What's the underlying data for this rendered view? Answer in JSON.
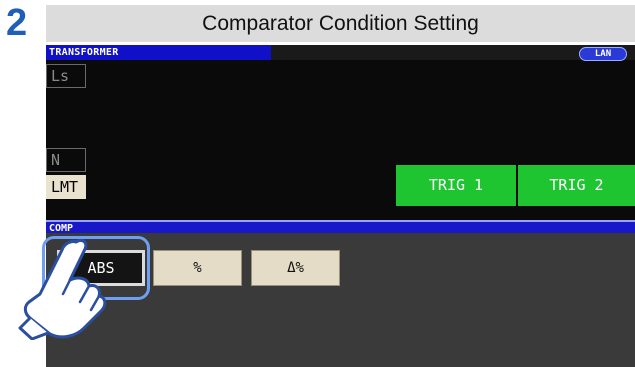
{
  "step": {
    "number": "2"
  },
  "title": "Comparator Condition Setting",
  "status_bar": {
    "mode": "TRANSFORMER",
    "interface": "LAN"
  },
  "parameters": [
    {
      "label": "Ls",
      "active": false
    },
    {
      "label": "N",
      "active": false
    },
    {
      "label": "LMT",
      "active": true
    }
  ],
  "triggers": [
    {
      "label": "TRIG 1"
    },
    {
      "label": "TRIG 2"
    }
  ],
  "comp": {
    "header": "COMP",
    "buttons": [
      {
        "label": "ABS",
        "selected": true
      },
      {
        "label": "%",
        "selected": false
      },
      {
        "label": "Δ%",
        "selected": false
      }
    ]
  },
  "colors": {
    "step_number": "#1f5fb7",
    "trigger": "#1ec531",
    "header_bar": "#1818c8",
    "highlight": "#6f9ff2"
  },
  "icons": {
    "pointer": "pointing-hand-icon"
  }
}
